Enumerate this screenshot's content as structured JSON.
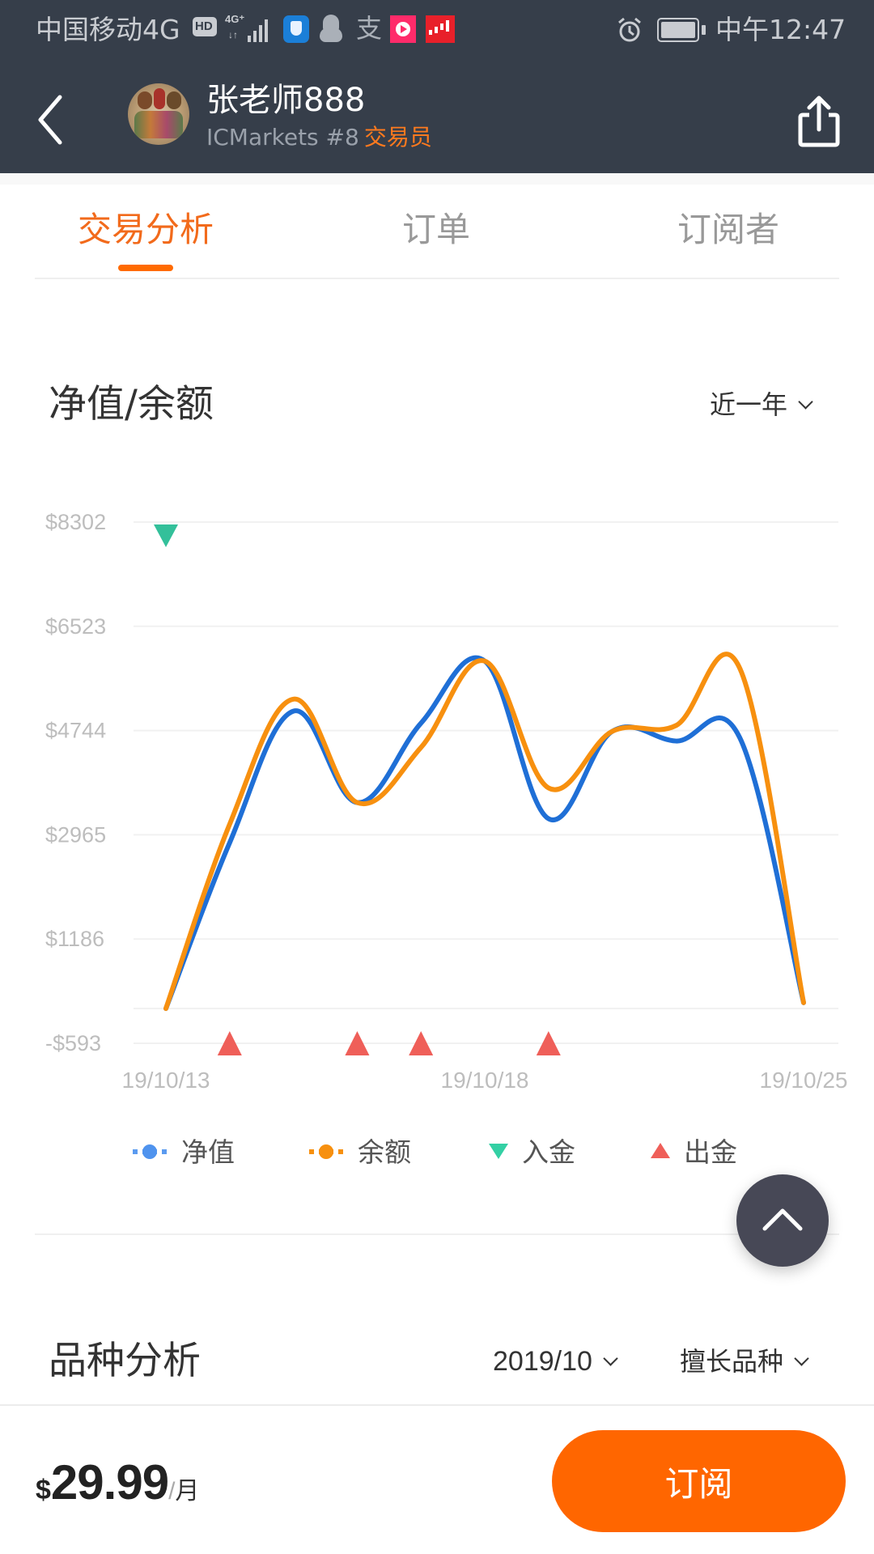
{
  "status_bar": {
    "carrier": "中国移动4G",
    "icons": [
      "hd-icon",
      "signal-4g-plus-icon",
      "shield-app-icon",
      "qq-icon",
      "alipay-icon",
      "video-app-icon",
      "stock-app-icon"
    ],
    "right_icons": [
      "alarm-icon",
      "battery-icon"
    ],
    "time": "中午12:47"
  },
  "header": {
    "back_icon": "chevron-left-icon",
    "trader_name": "张老师888",
    "broker": "ICMarkets #8",
    "role": "交易员",
    "share_icon": "share-icon"
  },
  "tabs": [
    {
      "label": "交易分析",
      "active": true
    },
    {
      "label": "订单",
      "active": false
    },
    {
      "label": "订阅者",
      "active": false
    }
  ],
  "equity_section": {
    "title": "净值/余额",
    "range_dropdown": "近一年"
  },
  "legend": [
    {
      "label": "净值",
      "color": "#1f6fd6"
    },
    {
      "label": "余额",
      "color": "#f7900f"
    },
    {
      "label": "入金",
      "color": "#33c09a"
    },
    {
      "label": "出金",
      "color": "#ef5f59"
    }
  ],
  "chart_data": {
    "type": "line",
    "title": "净值/余额",
    "x_tick_labels": [
      "19/10/13",
      "19/10/18",
      "19/10/25"
    ],
    "x_tick_indices": [
      0,
      5,
      10
    ],
    "y_tick_labels": [
      "$8302",
      "$6523",
      "$4744",
      "$2965",
      "$1186",
      "-$593"
    ],
    "y_ticks": [
      8302,
      6523,
      4744,
      2965,
      1186,
      -593
    ],
    "ylim": [
      -593,
      8302
    ],
    "grid": true,
    "legend_position": "bottom",
    "series": [
      {
        "name": "净值",
        "color": "#1f6fd6",
        "values": [
          0,
          2830,
          5075,
          3515,
          4870,
          5930,
          3240,
          4730,
          4565,
          4620,
          100
        ]
      },
      {
        "name": "余额",
        "color": "#f7900f",
        "values": [
          0,
          3145,
          5280,
          3515,
          4455,
          5930,
          3765,
          4730,
          4830,
          5805,
          100
        ]
      }
    ],
    "markers": [
      {
        "name": "入金",
        "type": "deposit",
        "indices": [
          0
        ],
        "color": "#33c09a"
      },
      {
        "name": "出金",
        "type": "withdrawal",
        "indices": [
          1,
          3,
          4,
          6
        ],
        "color": "#ef5f59"
      }
    ]
  },
  "symbol_section": {
    "title": "品种分析",
    "month_dropdown": "2019/10",
    "type_dropdown": "擅长品种"
  },
  "footer": {
    "currency": "$",
    "price": "29.99",
    "slash": "/",
    "unit": "月",
    "subscribe_label": "订阅"
  },
  "fab": {
    "icon": "chevron-up-icon"
  }
}
